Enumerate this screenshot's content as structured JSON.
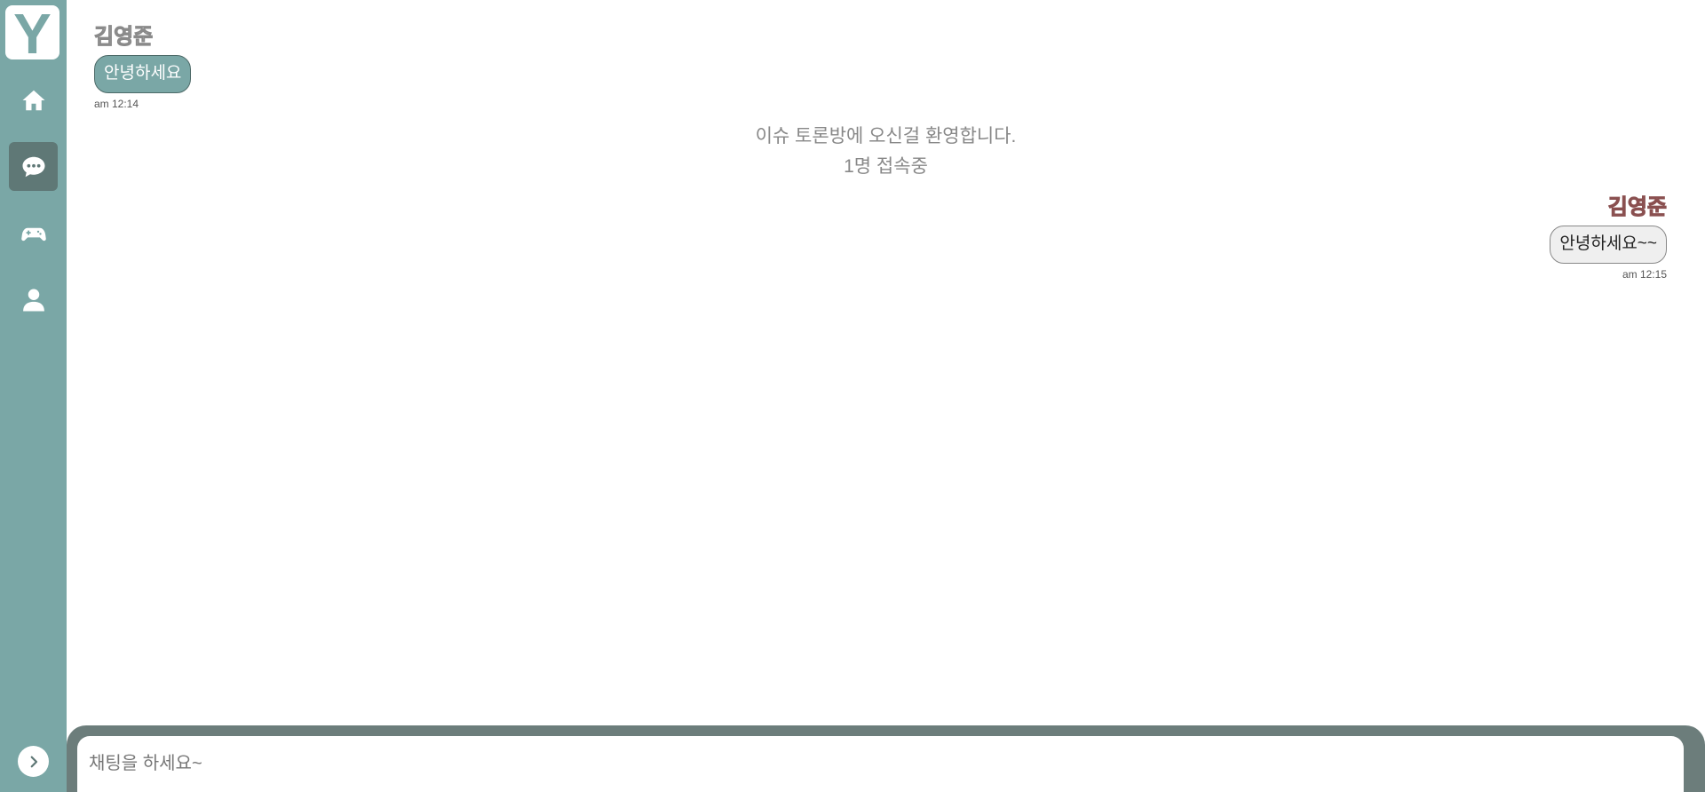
{
  "sidebar": {
    "logo_text": "Y",
    "items": [
      {
        "icon": "home-icon",
        "active": false
      },
      {
        "icon": "chat-icon",
        "active": true
      },
      {
        "icon": "gamepad-icon",
        "active": false
      },
      {
        "icon": "user-icon",
        "active": false
      }
    ],
    "expand_icon": "chevron-right-icon"
  },
  "messages": [
    {
      "side": "left",
      "sender": "김영준",
      "text": "안녕하세요",
      "time": "am 12:14"
    },
    {
      "side": "right",
      "sender": "김영준",
      "text": "안녕하세요~~",
      "time": "am 12:15"
    }
  ],
  "notice": {
    "welcome": "이슈 토론방에 오신걸 환영합니다.",
    "online": "1명 접속중"
  },
  "chat_input": {
    "placeholder": "채팅을 하세요~",
    "value": ""
  },
  "colors": {
    "sidebar": "#7aa7a6",
    "active_nav": "#5f7876",
    "input_bar": "#6c7d7b",
    "bubble_mine": "#efefef",
    "bubble_other": "#7aa7a6",
    "sender_mine": "#a06060"
  }
}
